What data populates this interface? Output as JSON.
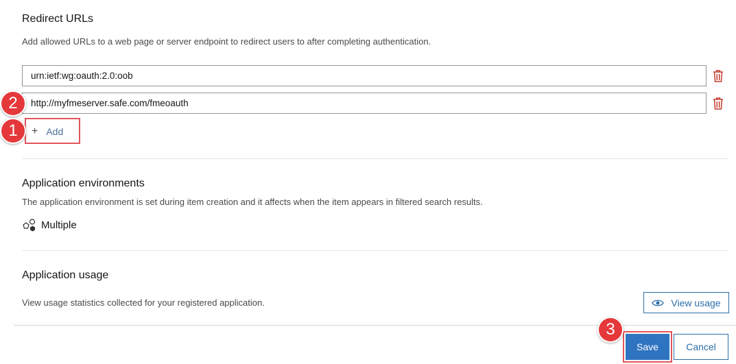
{
  "colors": {
    "accent": "#2f74c0",
    "accent_text": "#2b6ea8",
    "danger": "#c43b2e",
    "annotation": "#e5383b"
  },
  "redirect": {
    "title": "Redirect URLs",
    "description": "Add allowed URLs to a web page or server endpoint to redirect users to after completing authentication.",
    "urls": [
      {
        "value": "urn:ietf:wg:oauth:2.0:oob"
      },
      {
        "value": "http://myfmeserver.safe.com/fmeoauth"
      }
    ],
    "delete_icon": "trash-icon",
    "add_label": "Add",
    "add_icon": "plus-icon"
  },
  "environments": {
    "title": "Application environments",
    "description": "The application environment is set during item creation and it affects when the item appears in filtered search results.",
    "value": "Multiple",
    "icon": "shapes-icon"
  },
  "usage": {
    "title": "Application usage",
    "description": "View usage statistics collected for your registered application.",
    "button_label": "View usage",
    "button_icon": "eye-icon"
  },
  "footer": {
    "save_label": "Save",
    "cancel_label": "Cancel"
  },
  "annotations": {
    "step1": "1",
    "step2": "2",
    "step3": "3"
  }
}
